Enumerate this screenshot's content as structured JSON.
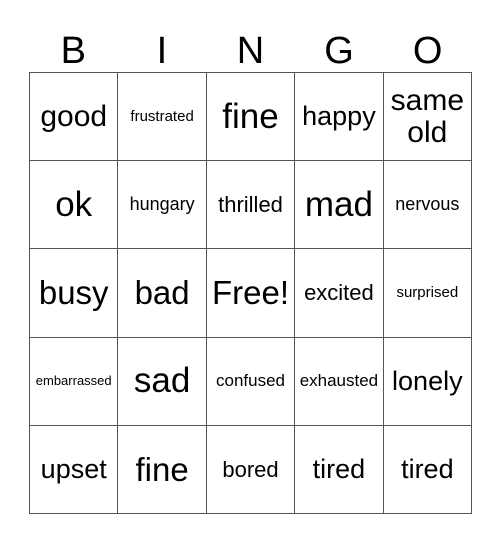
{
  "card": {
    "title_letters": [
      "B",
      "I",
      "N",
      "G",
      "O"
    ],
    "border_color": "#555555",
    "text_color": "#000000",
    "background_color": "#ffffff",
    "columns": 5,
    "rows": 5,
    "free_space_label": "Free!"
  },
  "grid": {
    "rows": [
      {
        "cells": [
          {
            "label": "good",
            "size": "xxl"
          },
          {
            "label": "frustrated",
            "size": "xs"
          },
          {
            "label": "fine",
            "size": "hh"
          },
          {
            "label": "happy",
            "size": "xl"
          },
          {
            "label": "same old",
            "size": "xxl"
          }
        ]
      },
      {
        "cells": [
          {
            "label": "ok",
            "size": "hh"
          },
          {
            "label": "hungary",
            "size": "m"
          },
          {
            "label": "thrilled",
            "size": "l"
          },
          {
            "label": "mad",
            "size": "hh"
          },
          {
            "label": "nervous",
            "size": "m"
          }
        ]
      },
      {
        "cells": [
          {
            "label": "busy",
            "size": "h"
          },
          {
            "label": "bad",
            "size": "h"
          },
          {
            "label": "Free!",
            "size": "h"
          },
          {
            "label": "excited",
            "size": "l"
          },
          {
            "label": "surprised",
            "size": "xs"
          }
        ]
      },
      {
        "cells": [
          {
            "label": "embarrassed",
            "size": "xxs"
          },
          {
            "label": "sad",
            "size": "hh"
          },
          {
            "label": "confused",
            "size": "s"
          },
          {
            "label": "exhausted",
            "size": "s"
          },
          {
            "label": "lonely",
            "size": "xl"
          }
        ]
      },
      {
        "cells": [
          {
            "label": "upset",
            "size": "xl"
          },
          {
            "label": "fine",
            "size": "h"
          },
          {
            "label": "bored",
            "size": "l"
          },
          {
            "label": "tired",
            "size": "xl"
          },
          {
            "label": "tired",
            "size": "xl"
          }
        ]
      }
    ]
  }
}
